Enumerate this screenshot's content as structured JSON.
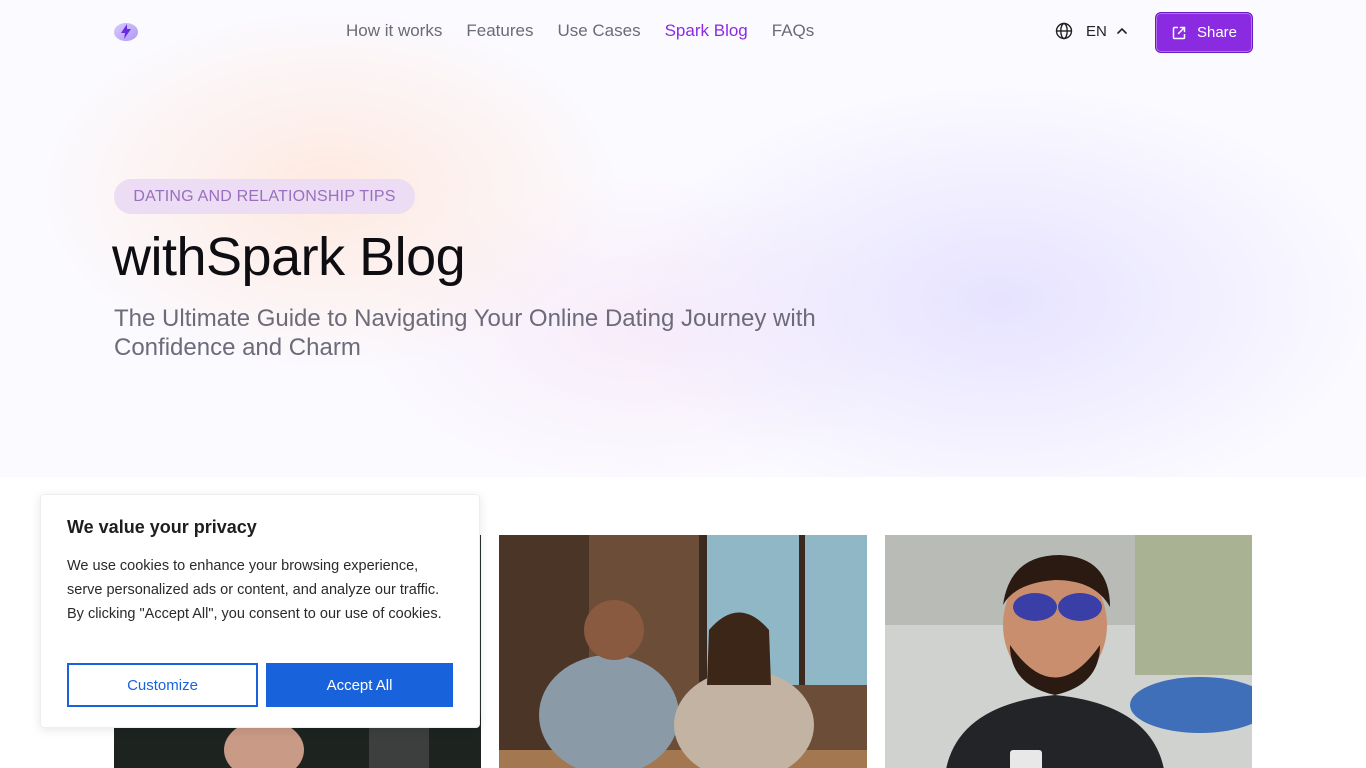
{
  "header": {
    "logo_icon": "spark-bolt-icon",
    "nav": [
      {
        "label": "How it works",
        "active": false
      },
      {
        "label": "Features",
        "active": false
      },
      {
        "label": "Use Cases",
        "active": false
      },
      {
        "label": "Spark Blog",
        "active": true
      },
      {
        "label": "FAQs",
        "active": false
      }
    ],
    "language": {
      "code": "EN",
      "icon": "globe-icon",
      "chevron": "chevron-up-icon"
    },
    "share_label": "Share",
    "share_icon": "external-link-icon"
  },
  "hero": {
    "tag": "DATING AND RELATIONSHIP TIPS",
    "title": "withSpark Blog",
    "subtitle": "The Ultimate Guide to Navigating Your Online Dating Journey with Confidence and Charm"
  },
  "cookie": {
    "title": "We value your privacy",
    "text": "We use cookies to enhance your browsing experience, serve personalized ads or content, and analyze our traffic. By clicking \"Accept All\", you consent to our use of cookies.",
    "customize_label": "Customize",
    "accept_label": "Accept All"
  },
  "colors": {
    "brand": "#8a2be2",
    "cookie_button": "#1863dc"
  }
}
